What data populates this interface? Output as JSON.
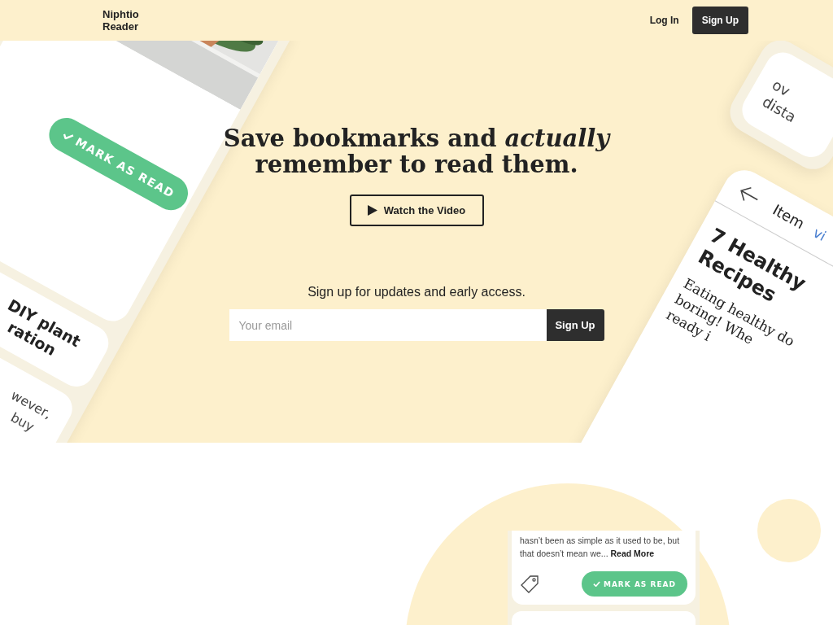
{
  "header": {
    "logo": "Niphtio Reader",
    "nav": [
      {
        "label": "Log In",
        "kind": "link"
      },
      {
        "label": "Sign Up",
        "kind": "button"
      }
    ]
  },
  "hero": {
    "title_lines": [
      "Save bookmarks and *actually*",
      "remember to read them."
    ],
    "video_button": "Watch the Video",
    "signup_prompt": "Sign up for updates and early access.",
    "email": {
      "placeholder": "Your email"
    },
    "submit": "Sign Up"
  },
  "mockups": {
    "left_phone": {
      "button": "MARK AS READ",
      "title_lines": [
        "DIY plant",
        "ration"
      ],
      "text_lines": [
        "wever,",
        "buy"
      ]
    },
    "top_right_card": {
      "text_lines": [
        "ov",
        "dista"
      ]
    },
    "right_phone": {
      "header": "Item",
      "link": "vi",
      "title_lines": [
        "7 Healthy",
        "Recipes"
      ],
      "body_lines": [
        "Eating healthy do",
        "boring! Whe",
        "ready i"
      ]
    }
  },
  "preview_card": {
    "text": "hasn’t been as simple as it used to be, but that doesn’t mean we... **Read More**",
    "button": "MARK AS READ"
  }
}
